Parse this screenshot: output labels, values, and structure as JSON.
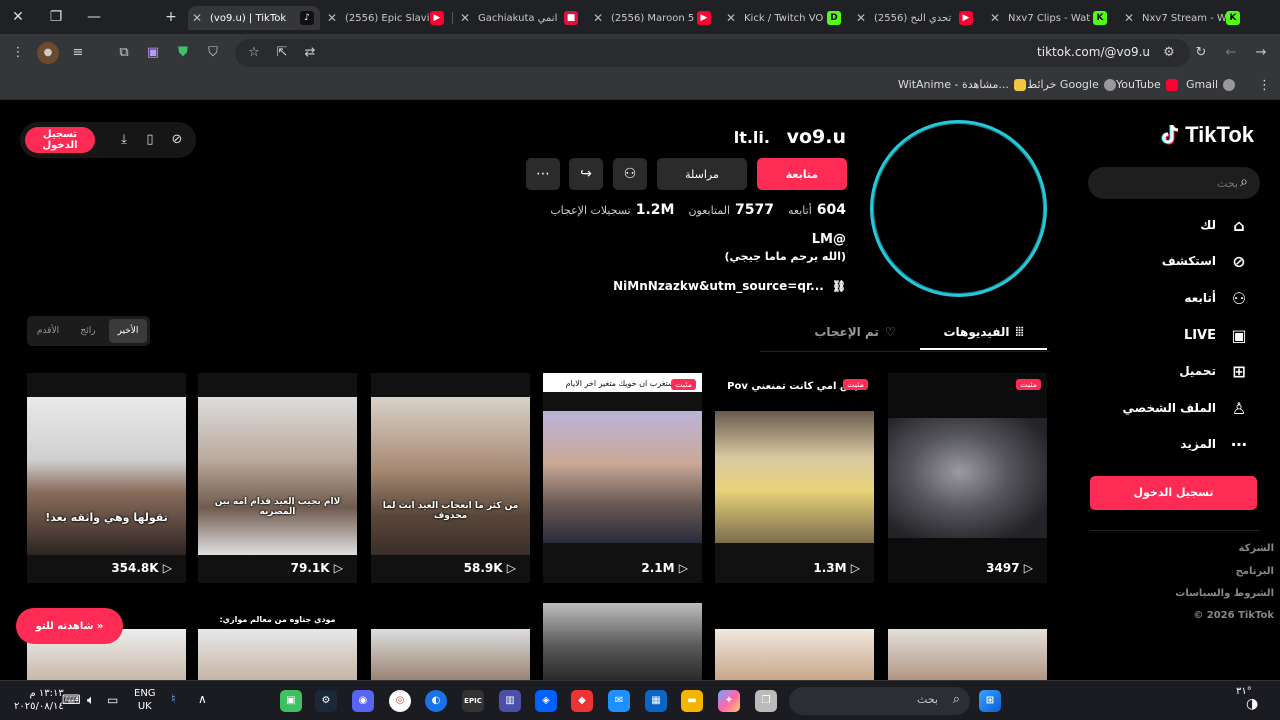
{
  "browser": {
    "tabs": [
      {
        "title": "(vo9.u) | TikTok",
        "active": true
      },
      {
        "title": "(2556) Epic Slavi",
        "active": false
      },
      {
        "title": "Gachiakuta انمي",
        "active": false
      },
      {
        "title": "(2556) Maroon 5",
        "active": false
      },
      {
        "title": "Kick / Twitch VO",
        "active": false
      },
      {
        "title": "(2556) تحدي النح",
        "active": false
      },
      {
        "title": "Nxv7 Clips - Wat",
        "active": false
      },
      {
        "title": "Nxv7 Stream - W",
        "active": false
      }
    ],
    "url": "tiktok.com/@vo9.u",
    "bookmarks": [
      "WitAnime - مشاهدة...",
      "خرائط Google",
      "YouTube",
      "Gmail"
    ]
  },
  "sidebar": {
    "logo": "TikTok",
    "search_placeholder": "بحث",
    "nav": [
      {
        "label": "لك",
        "icon": "home-icon"
      },
      {
        "label": "استكشف",
        "icon": "compass-icon"
      },
      {
        "label": "أتابعه",
        "icon": "following-icon"
      },
      {
        "label": "LIVE",
        "icon": "live-icon"
      },
      {
        "label": "تحميل",
        "icon": "upload-icon"
      },
      {
        "label": "الملف الشخصي",
        "icon": "profile-icon"
      },
      {
        "label": "المزيد",
        "icon": "more-icon"
      }
    ],
    "login_label": "تسجيل الدخول",
    "footer": [
      "الشركة",
      "البرنامج",
      "الشروط والسياسات",
      "© 2026 TikTok"
    ]
  },
  "topbar": {
    "login_label": "تسجيل الدخول"
  },
  "profile": {
    "username": "vo9.u",
    "nickname": "lt.li.",
    "follow_label": "متابعة",
    "message_label": "مراسلة",
    "following_count": "604",
    "following_label": "أتابعه",
    "followers_count": "7577",
    "followers_label": "المتابعون",
    "likes_count": "1.2M",
    "likes_label": "تسجيلات الإعجاب",
    "bio_line1": "LM@",
    "bio_line2": "(الله يرحم ماما جيجي)",
    "bio_link": "NiMnNzazkw&utm_source=qr..."
  },
  "tabs": {
    "videos": "الفيديوهات",
    "liked": "تم الإعجاب"
  },
  "sort": {
    "latest": "الأخير",
    "popular": "رائج",
    "oldest": "الأقدم"
  },
  "videos": [
    {
      "views": "354.8K",
      "caption": "تقولها وهي واثقه بعد!",
      "pinned": false
    },
    {
      "views": "79.1K",
      "caption": "لاام بجيب العيد قدام امه بين المصريه",
      "pinned": false
    },
    {
      "views": "58.9K",
      "caption": "من كثر ما انعجاب العيد ابث لما محدوف",
      "pinned": false
    },
    {
      "views": "2.1M",
      "caption": "مستغرب ان خويك متغير اخر الايام",
      "pinned": true,
      "pinned_label": "مثبت"
    },
    {
      "views": "1.3M",
      "caption": "Pov ليش امي كانت تمنعني",
      "pinned": true,
      "pinned_label": "مثبت"
    },
    {
      "views": "3497",
      "caption": "",
      "pinned": true,
      "pinned_label": "مثبت"
    }
  ],
  "row2_captions": [
    "مودي جناوه من معالم موازي:"
  ],
  "watch_button": "شاهدته للتو",
  "taskbar": {
    "search_label": "بحث",
    "lang": "ENG",
    "region": "UK",
    "time": "١٣:١٣ م",
    "date": "٢٠٢٥/٠٨/١٤",
    "weather": "٣١°"
  },
  "colors": {
    "accent": "#fe2c55",
    "avatar_ring": "#27c9d8"
  }
}
